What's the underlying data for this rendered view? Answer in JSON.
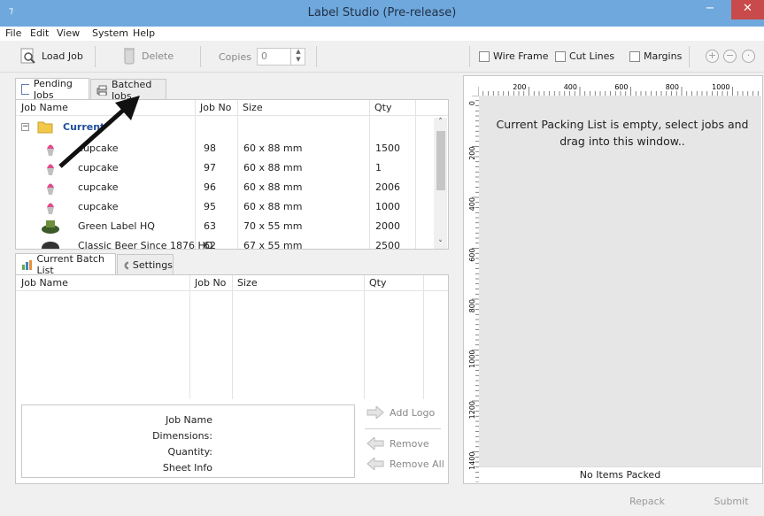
{
  "window": {
    "title": "Label Studio (Pre-release)",
    "min": "−",
    "max": "□",
    "close": "✕"
  },
  "menu": [
    "File",
    "Edit",
    "View",
    "System",
    "Help"
  ],
  "toolbar": {
    "load_job": "Load Job",
    "delete": "Delete",
    "copies_label": "Copies",
    "copies_value": "0",
    "wire_frame": "Wire Frame",
    "cut_lines": "Cut Lines",
    "margins": "Margins"
  },
  "top_tabs": {
    "pending": "Pending Jobs",
    "batched": "Batched Jobs"
  },
  "jobs_table": {
    "headers": [
      "Job Name",
      "Job No",
      "Size",
      "Qty"
    ],
    "group": "Current",
    "rows": [
      {
        "name": "cupcake",
        "no": "98",
        "size": "60 x 88  mm",
        "qty": "1500"
      },
      {
        "name": "cupcake",
        "no": "97",
        "size": "60 x 88  mm",
        "qty": "1"
      },
      {
        "name": "cupcake",
        "no": "96",
        "size": "60 x 88  mm",
        "qty": "2006"
      },
      {
        "name": "cupcake",
        "no": "95",
        "size": "60 x 88  mm",
        "qty": "1000"
      },
      {
        "name": "Green Label HQ",
        "no": "63",
        "size": "70 x 55  mm",
        "qty": "2000"
      },
      {
        "name": "Classic Beer Since 1876 HQ",
        "no": "62",
        "size": "67 x 55  mm",
        "qty": "2500"
      }
    ]
  },
  "bottom_tabs": {
    "batch": "Current Batch List",
    "settings": "Settings"
  },
  "batch_table": {
    "headers": [
      "Job Name",
      "Job No",
      "Size",
      "Qty"
    ]
  },
  "info": {
    "job_name": "Job Name",
    "dimensions": "Dimensions:",
    "quantity": "Quantity:",
    "sheet_info": "Sheet Info"
  },
  "side_buttons": {
    "add_logo": "Add Logo",
    "remove": "Remove",
    "remove_all": "Remove All"
  },
  "canvas": {
    "message": "Current Packing List is empty, select jobs and drag into this window..",
    "status": "No Items Packed",
    "ruler_top": [
      "200",
      "400",
      "600",
      "800",
      "1000"
    ],
    "ruler_left": [
      "0",
      "200",
      "400",
      "600",
      "800",
      "1000",
      "1200",
      "1400"
    ]
  },
  "bottom_buttons": {
    "repack": "Repack",
    "submit": "Submit"
  },
  "colors": {
    "titlebar": "#6fa8dc",
    "accent": "#1f4e9c",
    "close": "#c94a4a"
  }
}
